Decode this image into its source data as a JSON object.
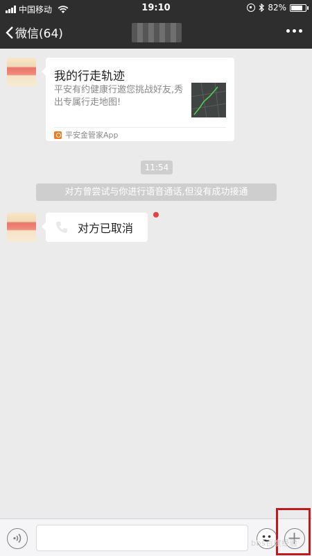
{
  "status_bar": {
    "carrier": "中国移动",
    "time": "19:10",
    "battery_text": "82%",
    "battery_level": 0.82,
    "icons": [
      "signal-icon",
      "wifi-icon",
      "rotation-lock-icon",
      "bluetooth-icon",
      "battery-icon"
    ]
  },
  "nav": {
    "back_label": "微信(64)",
    "more_icon": "more-dots-icon"
  },
  "messages": {
    "card": {
      "title": "我的行走轨迹",
      "description": "平安有约健康行邀您挑战好友,秀出专属行走地图!",
      "source": "平安金管家App"
    },
    "time": "11:54",
    "system_notice": "对方曾尝试与你进行语音通话,但没有成功接通",
    "call": {
      "text": "对方已取消"
    }
  },
  "input_bar": {
    "voice_icon": "voice-icon",
    "emoji_icon": "emoji-icon",
    "plus_icon": "plus-icon"
  },
  "watermark": "bbs百度经验"
}
